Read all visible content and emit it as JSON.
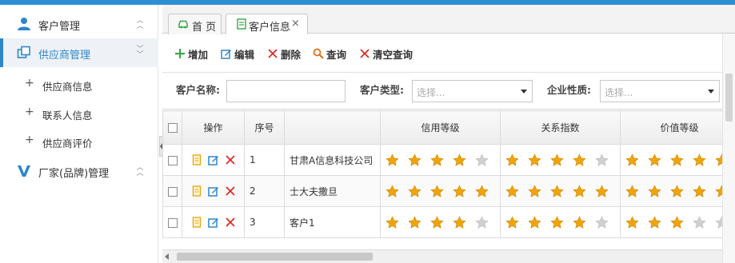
{
  "sidebar": {
    "groups": [
      {
        "label": "客户管理",
        "icon": "user-icon",
        "expanded": false
      },
      {
        "label": "供应商管理",
        "icon": "copy-icon",
        "expanded": true
      },
      {
        "label": "厂家(品牌)管理",
        "icon": "v-logo-icon",
        "expanded": false
      }
    ],
    "subitems": [
      {
        "label": "供应商信息"
      },
      {
        "label": "联系人信息"
      },
      {
        "label": "供应商评价"
      }
    ]
  },
  "tabs": [
    {
      "label": "首 页",
      "icon": "car-icon"
    },
    {
      "label": "客户信息",
      "icon": "document-icon",
      "closable": true,
      "close_glyph": "×"
    }
  ],
  "toolbar": {
    "add": "增加",
    "edit": "编辑",
    "delete": "删除",
    "query": "查询",
    "clear": "清空查询"
  },
  "filters": {
    "name_label": "客户名称:",
    "name_value": "",
    "type_label": "客户类型:",
    "type_placeholder": "选择...",
    "nature_label": "企业性质:",
    "nature_placeholder": "选择..."
  },
  "grid": {
    "columns": [
      "操作",
      "序号",
      "",
      "信用等级",
      "关系指数",
      "价值等级"
    ],
    "rows": [
      {
        "index": "1",
        "name": "甘肃A信息科技公司",
        "credit": 4,
        "relation": 4,
        "value": 5
      },
      {
        "index": "2",
        "name": "士大夫撒旦",
        "credit": 5,
        "relation": 5,
        "value": 5
      },
      {
        "index": "3",
        "name": "客户1",
        "credit": 4,
        "relation": 4,
        "value": 3
      }
    ],
    "max_stars": 5
  },
  "colors": {
    "accent": "#2f86c9",
    "star_filled": "#f0a30a",
    "star_empty": "#d0d0d0",
    "danger": "#e02020"
  }
}
